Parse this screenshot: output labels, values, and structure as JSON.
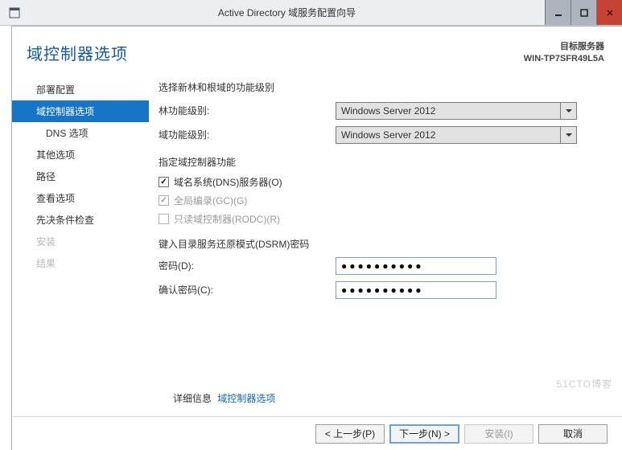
{
  "titlebar": {
    "title": "Active Directory 域服务配置向导"
  },
  "header": {
    "title": "域控制器选项",
    "target_label": "目标服务器",
    "target_value": "WIN-TP7SFR49L5A"
  },
  "nav": {
    "items": [
      {
        "id": "deploy",
        "label": "部署配置"
      },
      {
        "id": "dcoptions",
        "label": "域控制器选项",
        "active": true
      },
      {
        "id": "dns",
        "label": "DNS 选项",
        "sub": true
      },
      {
        "id": "other",
        "label": "其他选项"
      },
      {
        "id": "path",
        "label": "路径"
      },
      {
        "id": "review",
        "label": "查看选项"
      },
      {
        "id": "prereq",
        "label": "先决条件检查"
      },
      {
        "id": "install",
        "label": "安装",
        "disabled": true
      },
      {
        "id": "result",
        "label": "结果",
        "disabled": true
      }
    ]
  },
  "content": {
    "level_heading": "选择新林和根域的功能级别",
    "forest_label": "林功能级别:",
    "forest_value": "Windows Server 2012",
    "domain_label": "域功能级别:",
    "domain_value": "Windows Server 2012",
    "cap_heading": "指定域控制器功能",
    "cb_dns": "域名系统(DNS)服务器(O)",
    "cb_gc": "全局编录(GC)(G)",
    "cb_rodc": "只读域控制器(RODC)(R)",
    "dsrm_heading": "键入目录服务还原模式(DSRM)密码",
    "pwd_label": "密码(D):",
    "pwd_value": "●●●●●●●●●●",
    "pwd2_label": "确认密码(C):",
    "pwd2_value": "●●●●●●●●●●"
  },
  "links": {
    "more_info": "详细信息",
    "topic": "域控制器选项"
  },
  "footer": {
    "prev": "< 上一步(P)",
    "next": "下一步(N) >",
    "install": "安装(I)",
    "cancel": "取消"
  },
  "watermark": "51CTO博客"
}
